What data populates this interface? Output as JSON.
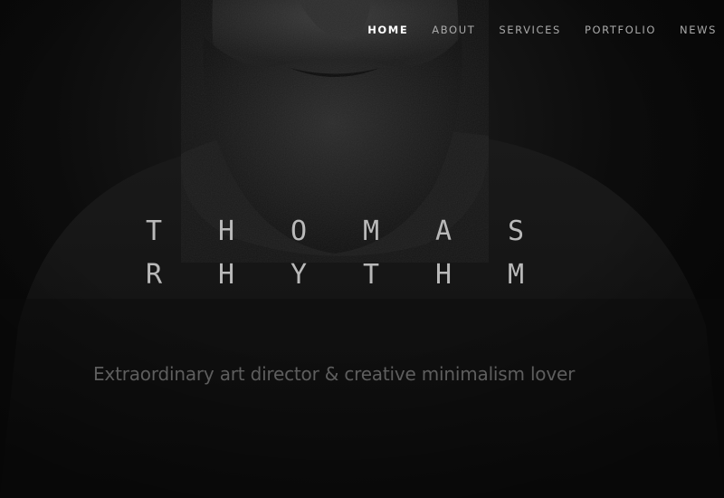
{
  "nav": {
    "items": [
      {
        "label": "HOME",
        "active": true
      },
      {
        "label": "ABOUT",
        "active": false
      },
      {
        "label": "SERVICES",
        "active": false
      },
      {
        "label": "PORTFOLIO",
        "active": false
      },
      {
        "label": "NEWS",
        "active": false
      }
    ]
  },
  "hero": {
    "first_name": "THOMAS",
    "last_name": "RHYTHM",
    "tagline": "Extraordinary art director & creative minimalism lover"
  },
  "colors": {
    "background": "#0b0b0b",
    "nav_text": "#a9a9a9",
    "nav_active": "#ffffff",
    "name_text": "#b9b9b9",
    "tagline_text": "#5e5e5e"
  }
}
